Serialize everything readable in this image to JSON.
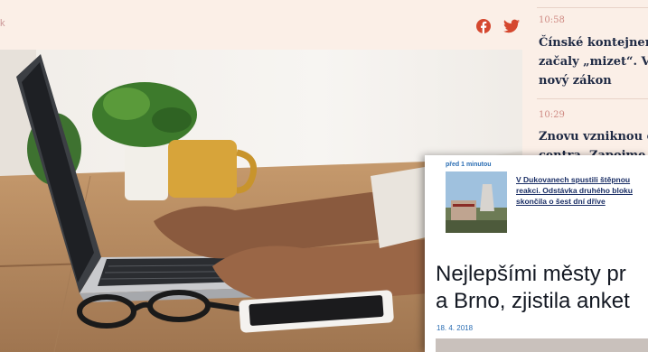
{
  "top_bar": {
    "left_text": "k",
    "icons": [
      "facebook-icon",
      "twitter-icon"
    ],
    "icon_color": "#d5482f"
  },
  "sidebar": {
    "items": [
      {
        "time": "10:58",
        "headline_lines": [
          "Čínské kontejner",
          "začaly „mizet“. Vi",
          "nový zákon"
        ]
      },
      {
        "time": "10:29",
        "headline_lines": [
          "Znovu vzniknou č",
          "centra. Zapojme"
        ]
      }
    ]
  },
  "popup": {
    "ago": "před 1 minutou",
    "story_title": "V Dukovanech spustili štěpnou reakci. Odstávka druhého bloku skončila o šest dní dříve",
    "headline_lines": [
      "Nejlepšími městy pr",
      "a Brno, zjistila anket"
    ],
    "date": "18. 4. 2018",
    "link_color": "#2a6db3"
  },
  "hero_image": {
    "description_icon": "laptop-photo"
  }
}
